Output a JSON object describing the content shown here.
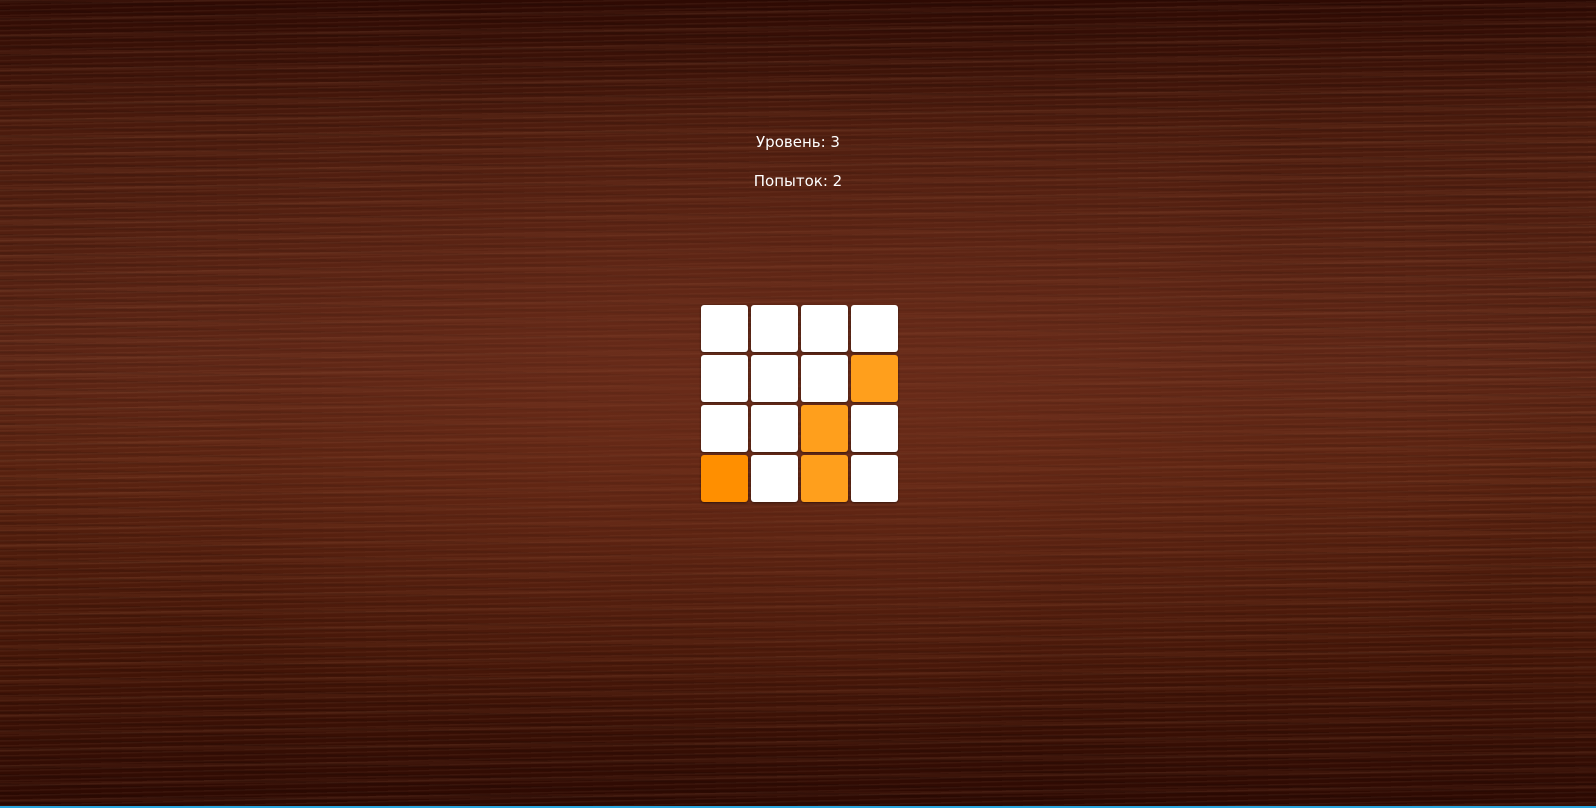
{
  "hud": {
    "level_text": "Уровень: 3",
    "attempts_text": "Попыток: 2"
  },
  "board": {
    "size": 4,
    "cells": [
      [
        0,
        0,
        0,
        0
      ],
      [
        0,
        0,
        0,
        1
      ],
      [
        0,
        0,
        1,
        0
      ],
      [
        1,
        0,
        1,
        0
      ]
    ],
    "colors": {
      "off": "#ffffff",
      "on": "#ff9f1c",
      "accent_bottom_line": "#2aa6e0"
    }
  }
}
